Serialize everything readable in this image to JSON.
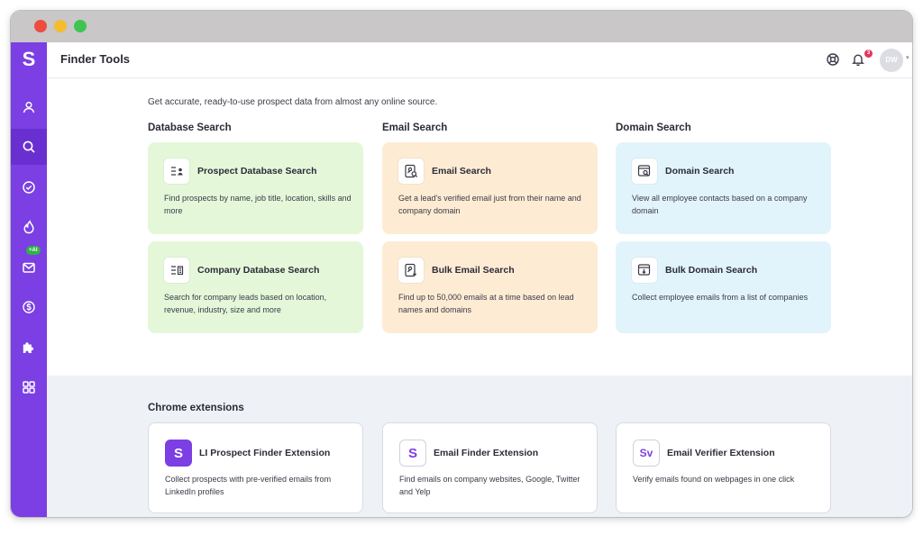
{
  "app": {
    "logo": "S",
    "page_title": "Finder Tools"
  },
  "header": {
    "notification_count": "3",
    "avatar_initials": "DW"
  },
  "sidebar": {
    "items": [
      {
        "name": "user-icon"
      },
      {
        "name": "search-icon",
        "active": true
      },
      {
        "name": "check-circle-icon"
      },
      {
        "name": "flame-icon"
      },
      {
        "name": "mail-icon",
        "badge": "+AI"
      },
      {
        "name": "dollar-icon"
      },
      {
        "name": "puzzle-icon"
      },
      {
        "name": "apps-grid-icon"
      }
    ]
  },
  "main": {
    "intro": "Get accurate, ready-to-use prospect data from almost any online source.",
    "sections": {
      "database": {
        "title": "Database Search",
        "cards": [
          {
            "title": "Prospect Database Search",
            "desc": "Find prospects by name, job title, location, skills and more"
          },
          {
            "title": "Company Database Search",
            "desc": "Search for company leads based on location, revenue, industry, size and more"
          }
        ]
      },
      "email": {
        "title": "Email Search",
        "cards": [
          {
            "title": "Email Search",
            "desc": "Get a lead's verified email just from their name and company domain"
          },
          {
            "title": "Bulk Email Search",
            "desc": "Find up to 50,000 emails at a time based on lead names and domains"
          }
        ]
      },
      "domain": {
        "title": "Domain Search",
        "cards": [
          {
            "title": "Domain Search",
            "desc": "View all employee contacts based on a company domain"
          },
          {
            "title": "Bulk Domain Search",
            "desc": "Collect employee emails from a list of companies"
          }
        ]
      }
    },
    "extensions": {
      "title": "Chrome extensions",
      "items": [
        {
          "icon": "S",
          "title": "LI Prospect Finder Extension",
          "desc": "Collect prospects with pre-verified emails from LinkedIn profiles"
        },
        {
          "icon": "S",
          "title": "Email Finder Extension",
          "desc": "Find emails on company websites, Google, Twitter and Yelp"
        },
        {
          "icon": "Sv",
          "title": "Email Verifier Extension",
          "desc": "Verify emails found on webpages in one click"
        }
      ]
    }
  },
  "colors": {
    "brand": "#7b3fe4",
    "card_green": "#e4f8d9",
    "card_orange": "#fdecd3",
    "card_blue": "#e2f4fb",
    "badge_red": "#e5335b",
    "ai_green": "#2fb24a"
  }
}
